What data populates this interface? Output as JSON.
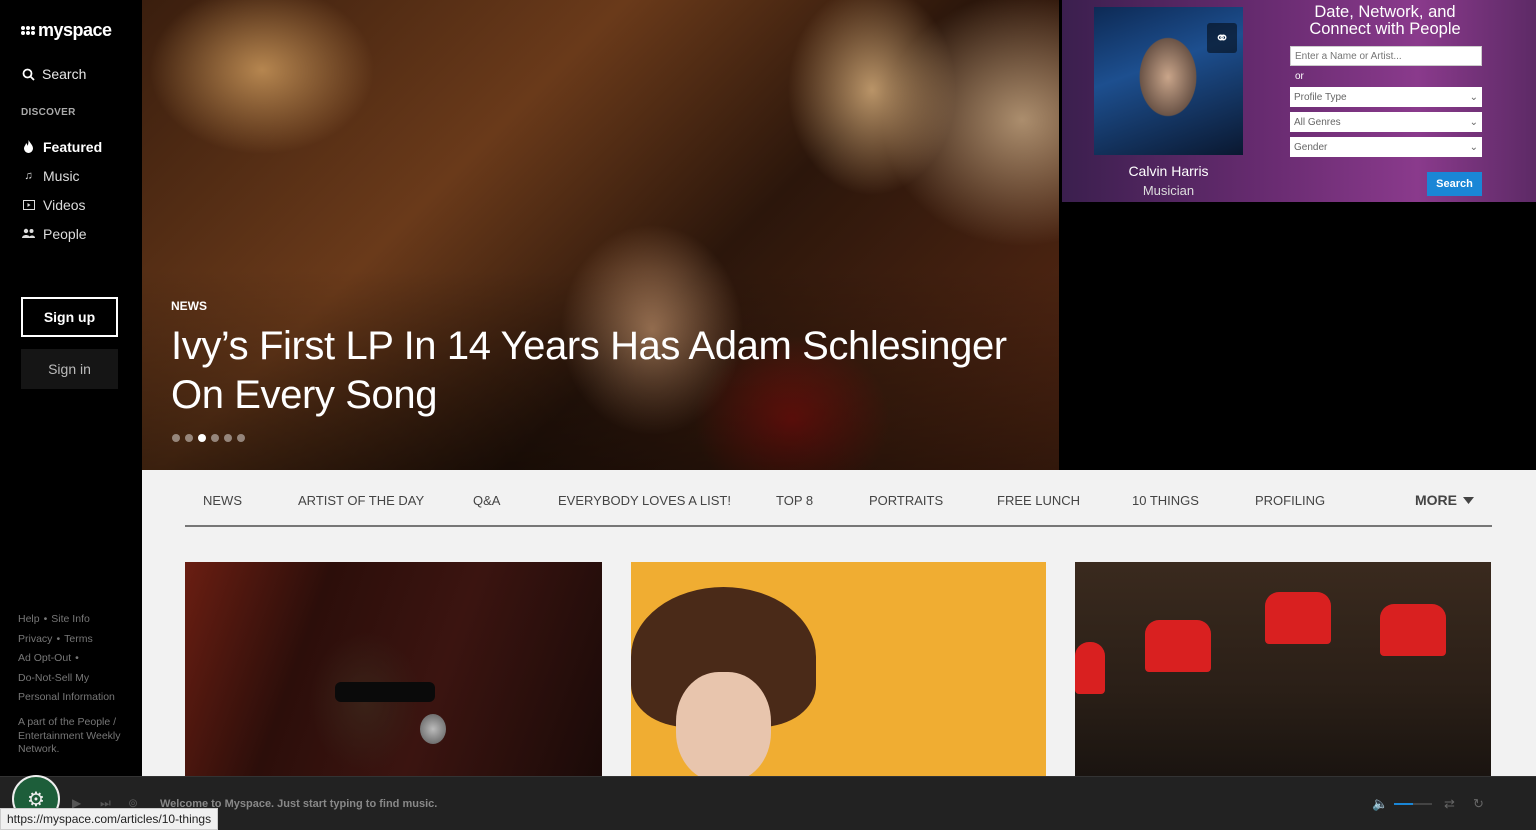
{
  "sidebar": {
    "logo": "myspace",
    "search": "Search",
    "discover": "DISCOVER",
    "nav": [
      {
        "label": "Featured",
        "icon": "flame-icon"
      },
      {
        "label": "Music",
        "icon": "music-note-icon"
      },
      {
        "label": "Videos",
        "icon": "video-icon"
      },
      {
        "label": "People",
        "icon": "people-icon"
      }
    ],
    "signup": "Sign up",
    "signin": "Sign in",
    "footer": {
      "help": "Help",
      "site_info": "Site Info",
      "privacy": "Privacy",
      "terms": "Terms",
      "ad_opt_out": "Ad Opt-Out",
      "do_not_sell_1": "Do-Not-Sell My",
      "do_not_sell_2": "Personal Information",
      "network_note": "A part of the People / Entertainment Weekly Network."
    }
  },
  "hero": {
    "tag": "NEWS",
    "title": "Ivy’s First LP In 14 Years Has Adam Schlesinger On Every Song",
    "slides": 6,
    "active_slide": 3
  },
  "ad": {
    "heading": "Date, Network, and Connect with People",
    "name": "Calvin Harris",
    "role": "Musician",
    "input_placeholder": "Enter a Name or Artist...",
    "or": "or",
    "selects": [
      "Profile Type",
      "All Genres",
      "Gender"
    ],
    "button": "Search"
  },
  "tabs": [
    "NEWS",
    "ARTIST OF THE DAY",
    "Q&A",
    "EVERYBODY LOVES A LIST!",
    "TOP 8",
    "PORTRAITS",
    "FREE LUNCH",
    "10 THINGS",
    "PROFILING"
  ],
  "tabs_more": "MORE",
  "player": {
    "message": "Welcome to Myspace. Just start typing to find music.",
    "volume": 0.5
  },
  "status_url": "https://myspace.com/articles/10-things"
}
